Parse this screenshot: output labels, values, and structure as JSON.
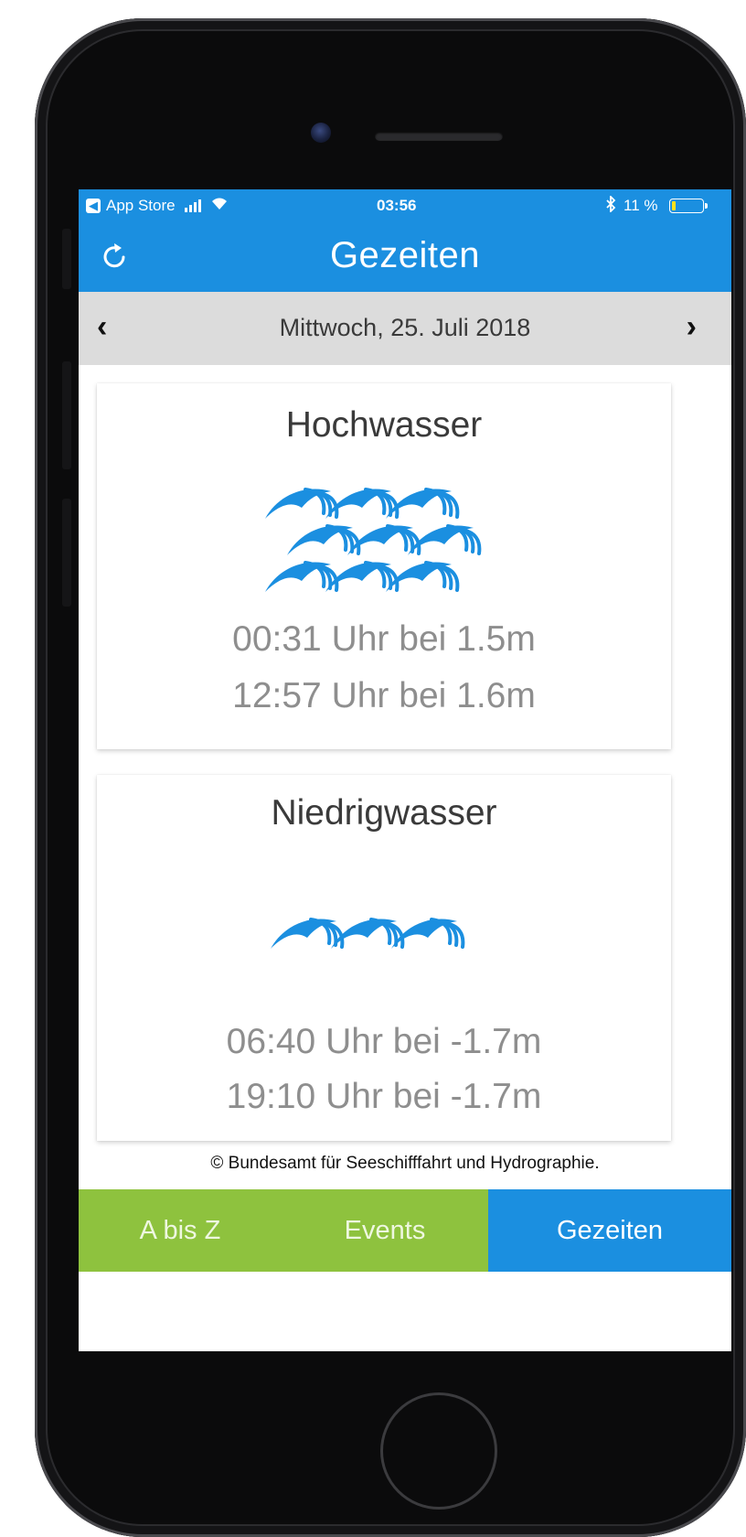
{
  "status_bar": {
    "back_app": "App Store",
    "time": "03:56",
    "battery_text": "11 %",
    "battery_level": 0.11,
    "accent": "#1b8fe0"
  },
  "header": {
    "title": "Gezeiten",
    "refresh_icon": "refresh-icon"
  },
  "date_bar": {
    "date": "Mittwoch, 25. Juli 2018",
    "prev": "‹",
    "next": "›"
  },
  "cards": {
    "high": {
      "title": "Hochwasser",
      "icon": "high-waves-icon",
      "times": [
        "00:31 Uhr bei 1.5m",
        "12:57 Uhr bei 1.6m"
      ]
    },
    "low": {
      "title": "Niedrigwasser",
      "icon": "low-waves-icon",
      "times": [
        "06:40 Uhr bei -1.7m",
        "19:10 Uhr bei -1.7m"
      ]
    }
  },
  "copyright": "© Bundesamt für Seeschifffahrt und Hydrographie.",
  "tabs": [
    {
      "label": "A bis Z",
      "color": "#8ec23e",
      "active": false
    },
    {
      "label": "Events",
      "color": "#8ec23e",
      "active": false
    },
    {
      "label": "Gezeiten",
      "color": "#1b8fe0",
      "active": true
    }
  ]
}
